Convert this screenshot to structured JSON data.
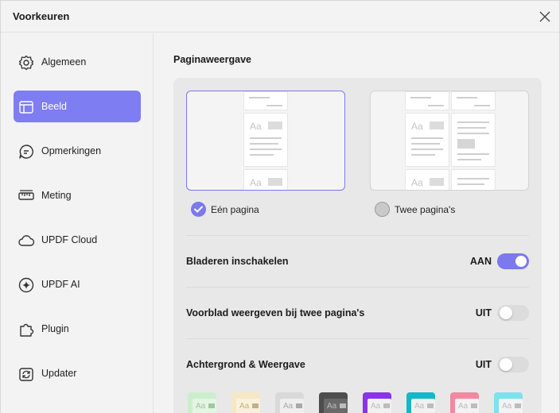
{
  "window": {
    "title": "Voorkeuren"
  },
  "sidebar": {
    "items": [
      {
        "label": "Algemeen",
        "icon": "gear-icon"
      },
      {
        "label": "Beeld",
        "icon": "layout-icon",
        "active": true
      },
      {
        "label": "Opmerkingen",
        "icon": "comment-icon"
      },
      {
        "label": "Meting",
        "icon": "ruler-icon"
      },
      {
        "label": "UPDF Cloud",
        "icon": "cloud-icon"
      },
      {
        "label": "UPDF AI",
        "icon": "ai-sparkle-icon"
      },
      {
        "label": "Plugin",
        "icon": "puzzle-icon"
      },
      {
        "label": "Updater",
        "icon": "update-icon"
      }
    ]
  },
  "main": {
    "section_title": "Paginaweergave",
    "page_layout": {
      "options": [
        {
          "label": "Eén pagina",
          "selected": true
        },
        {
          "label": "Twee pagina's",
          "selected": false
        }
      ],
      "thumb_text": "Aa"
    },
    "settings": [
      {
        "label": "Bladeren inschakelen",
        "state": "AAN",
        "on": true
      },
      {
        "label": "Voorblad weergeven bij twee pagina's",
        "state": "UIT",
        "on": false
      },
      {
        "label": "Achtergrond & Weergave",
        "state": "UIT",
        "on": false
      }
    ],
    "themes": [
      {
        "name": "green-theme",
        "bg": "#cdeecd",
        "sheet": "#e3f5e3",
        "text": "#9fc79f"
      },
      {
        "name": "cream-theme",
        "bg": "#f6e8c7",
        "sheet": "#faf1dc",
        "text": "#c4b086"
      },
      {
        "name": "light-gray-theme",
        "bg": "#d9d9d9",
        "sheet": "#eeeeee",
        "text": "#a9a9a9"
      },
      {
        "name": "dark-gray-theme",
        "bg": "#4d4d4d",
        "sheet": "#6a6a6a",
        "text": "#bdbdbd"
      },
      {
        "name": "purple-theme",
        "bg": "#8a34e8",
        "sheet": "#f1f1f1",
        "text": "#bcbcbc"
      },
      {
        "name": "teal-theme",
        "bg": "#14b7c9",
        "sheet": "#f1f1f1",
        "text": "#bcbcbc"
      },
      {
        "name": "gradient-theme",
        "bg": "#f08aa0",
        "sheet": "#f3f3f3",
        "text": "#bcbcbc"
      },
      {
        "name": "cyan-theme",
        "bg": "#7fe0ee",
        "sheet": "#f3f3f3",
        "text": "#bcbcbc"
      }
    ]
  }
}
